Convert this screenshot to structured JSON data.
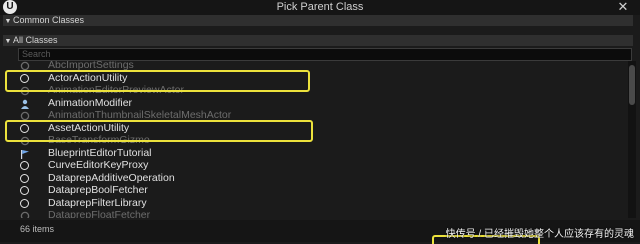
{
  "window": {
    "title": "Pick Parent Class",
    "close_glyph": "✕"
  },
  "sections": {
    "common": "Common Classes",
    "all": "All Classes"
  },
  "search": {
    "placeholder": "Search"
  },
  "classes": [
    {
      "label": "AbcImportSettings",
      "icon": "generic-class-icon",
      "faded": true
    },
    {
      "label": "ActorActionUtility",
      "icon": "class-ring-icon",
      "faded": false
    },
    {
      "label": "AnimationEditorPreviewActor",
      "icon": "generic-class-icon",
      "faded": true
    },
    {
      "label": "AnimationModifier",
      "icon": "person-icon",
      "faded": false
    },
    {
      "label": "AnimationThumbnailSkeletalMeshActor",
      "icon": "generic-class-icon",
      "faded": true
    },
    {
      "label": "AssetActionUtility",
      "icon": "class-ring-icon",
      "faded": false
    },
    {
      "label": "BaseTransformGizmo",
      "icon": "generic-class-icon",
      "faded": true
    },
    {
      "label": "BlueprintEditorTutorial",
      "icon": "flag-icon",
      "faded": false
    },
    {
      "label": "CurveEditorKeyProxy",
      "icon": "class-ring-icon",
      "faded": false
    },
    {
      "label": "DataprepAdditiveOperation",
      "icon": "class-ring-icon",
      "faded": false
    },
    {
      "label": "DataprepBoolFetcher",
      "icon": "class-ring-icon",
      "faded": false
    },
    {
      "label": "DataprepFilterLibrary",
      "icon": "class-ring-icon",
      "faded": false
    },
    {
      "label": "DataprepFloatFetcher",
      "icon": "generic-class-icon",
      "faded": true
    }
  ],
  "footer": {
    "count": "66 items"
  },
  "watermark": "快传号 / 已经摧毁她整个人应该存有的灵魂",
  "colors": {
    "highlight": "#ece23c",
    "background": "#1b1b1b"
  }
}
